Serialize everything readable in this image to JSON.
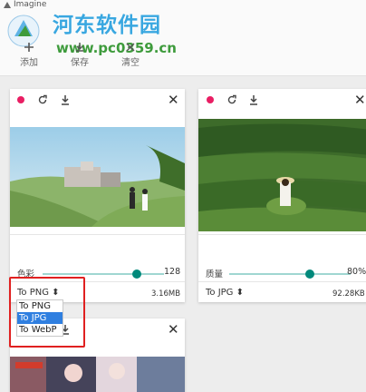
{
  "window": {
    "title": "Imagine"
  },
  "watermark": {
    "text": "河东软件园",
    "url": "www.pc0359.cn"
  },
  "toolbar": {
    "items": [
      {
        "label": "添加",
        "icon": "add-icon"
      },
      {
        "label": "保存",
        "icon": "save-icon"
      },
      {
        "label": "清空",
        "icon": "clear-icon"
      }
    ]
  },
  "cards": [
    {
      "slider_label": "色彩",
      "slider_value": "128",
      "slider_fraction": 0.84,
      "format": "To PNG ⬍",
      "size": "3.16MB"
    },
    {
      "slider_label": "质量",
      "slider_value": "80%",
      "slider_fraction": 0.8,
      "format": "To JPG ⬍",
      "size": "92.28KB"
    }
  ],
  "format_dropdown": {
    "options": [
      "To PNG",
      "To JPG",
      "To WebP"
    ],
    "selected": "To JPG"
  },
  "colors": {
    "accent": "#00897b",
    "dot": "#e91e63",
    "highlight": "#e02020"
  }
}
